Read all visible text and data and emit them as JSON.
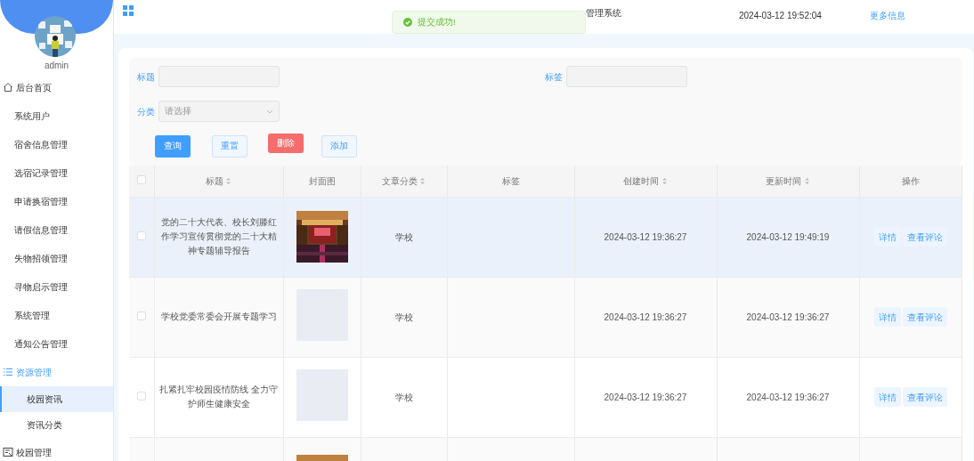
{
  "sidebar": {
    "username": "admin",
    "items": [
      {
        "label": "后台首页",
        "kind": "home",
        "selected": false
      },
      {
        "label": "系统用户",
        "kind": "plain",
        "selected": false
      },
      {
        "label": "宿舍信息管理",
        "kind": "plain",
        "selected": false
      },
      {
        "label": "选宿记录管理",
        "kind": "plain",
        "selected": false
      },
      {
        "label": "申请换宿管理",
        "kind": "plain",
        "selected": false
      },
      {
        "label": "请假信息管理",
        "kind": "plain",
        "selected": false
      },
      {
        "label": "失物招领管理",
        "kind": "plain",
        "selected": false
      },
      {
        "label": "寻物启示管理",
        "kind": "plain",
        "selected": false
      },
      {
        "label": "系统管理",
        "kind": "plain",
        "selected": false
      },
      {
        "label": "通知公告管理",
        "kind": "plain",
        "selected": false
      },
      {
        "label": "资源管理",
        "kind": "list",
        "selected": false,
        "expanded": true,
        "children": [
          {
            "label": "校园资讯",
            "selected": true
          },
          {
            "label": "资讯分类",
            "selected": false
          }
        ]
      },
      {
        "label": "校园管理",
        "kind": "form",
        "selected": false
      }
    ]
  },
  "header": {
    "title": "管理系统",
    "datetime": "2024-03-12 19:52:04",
    "more_link": "更多信息"
  },
  "toast": {
    "message": "提交成功!"
  },
  "filter_rows": [
    [
      {
        "label": "标题",
        "kind": "input"
      },
      {
        "label": "标签",
        "kind": "input"
      }
    ],
    [
      {
        "label": "分类",
        "kind": "select",
        "placeholder": "请选择"
      }
    ]
  ],
  "buttons": [
    {
      "label": "查询",
      "kind": "primary"
    },
    {
      "label": "重置",
      "kind": "plain"
    },
    {
      "label": "删除",
      "kind": "danger"
    },
    {
      "label": "添加",
      "kind": "plain"
    }
  ],
  "table": {
    "select_all_checked": false,
    "columns": [
      {
        "label": "标题",
        "sortable": true
      },
      {
        "label": "封面图",
        "sortable": false
      },
      {
        "label": "文章分类",
        "sortable": true
      },
      {
        "label": "标签",
        "sortable": false
      },
      {
        "label": "创建时间",
        "sortable": true
      },
      {
        "label": "更新时间",
        "sortable": true
      },
      {
        "label": "操作",
        "sortable": false
      }
    ],
    "rows": [
      {
        "checked": false,
        "hovered": true,
        "title": "党的二十大代表、校长刘滕红作学习宣传贯彻党的二十大精神专题辅导报告",
        "category": "学校",
        "created": "2024-03-12 19:36:27",
        "updated": "2024-03-12 19:49:19",
        "actions": [
          "详情",
          "查看评论"
        ]
      },
      {
        "checked": false,
        "hovered": false,
        "title": "学校党委常委会开展专题学习",
        "cover": {
          "kind": "empty"
        },
        "category": "学校",
        "created": "2024-03-12 19:36:27",
        "updated": "2024-03-12 19:36:27",
        "actions": [
          "详情",
          "查看评论"
        ]
      },
      {
        "checked": false,
        "hovered": false,
        "title": "扎紧扎牢校园疫情防线 全力守护师生健康安全",
        "cover": {
          "kind": "empty"
        },
        "category": "学校",
        "created": "2024-03-12 19:36:27",
        "updated": "2024-03-12 19:36:27",
        "actions": [
          "详情",
          "查看评论"
        ]
      },
      {
        "hovered": false
      }
    ]
  }
}
